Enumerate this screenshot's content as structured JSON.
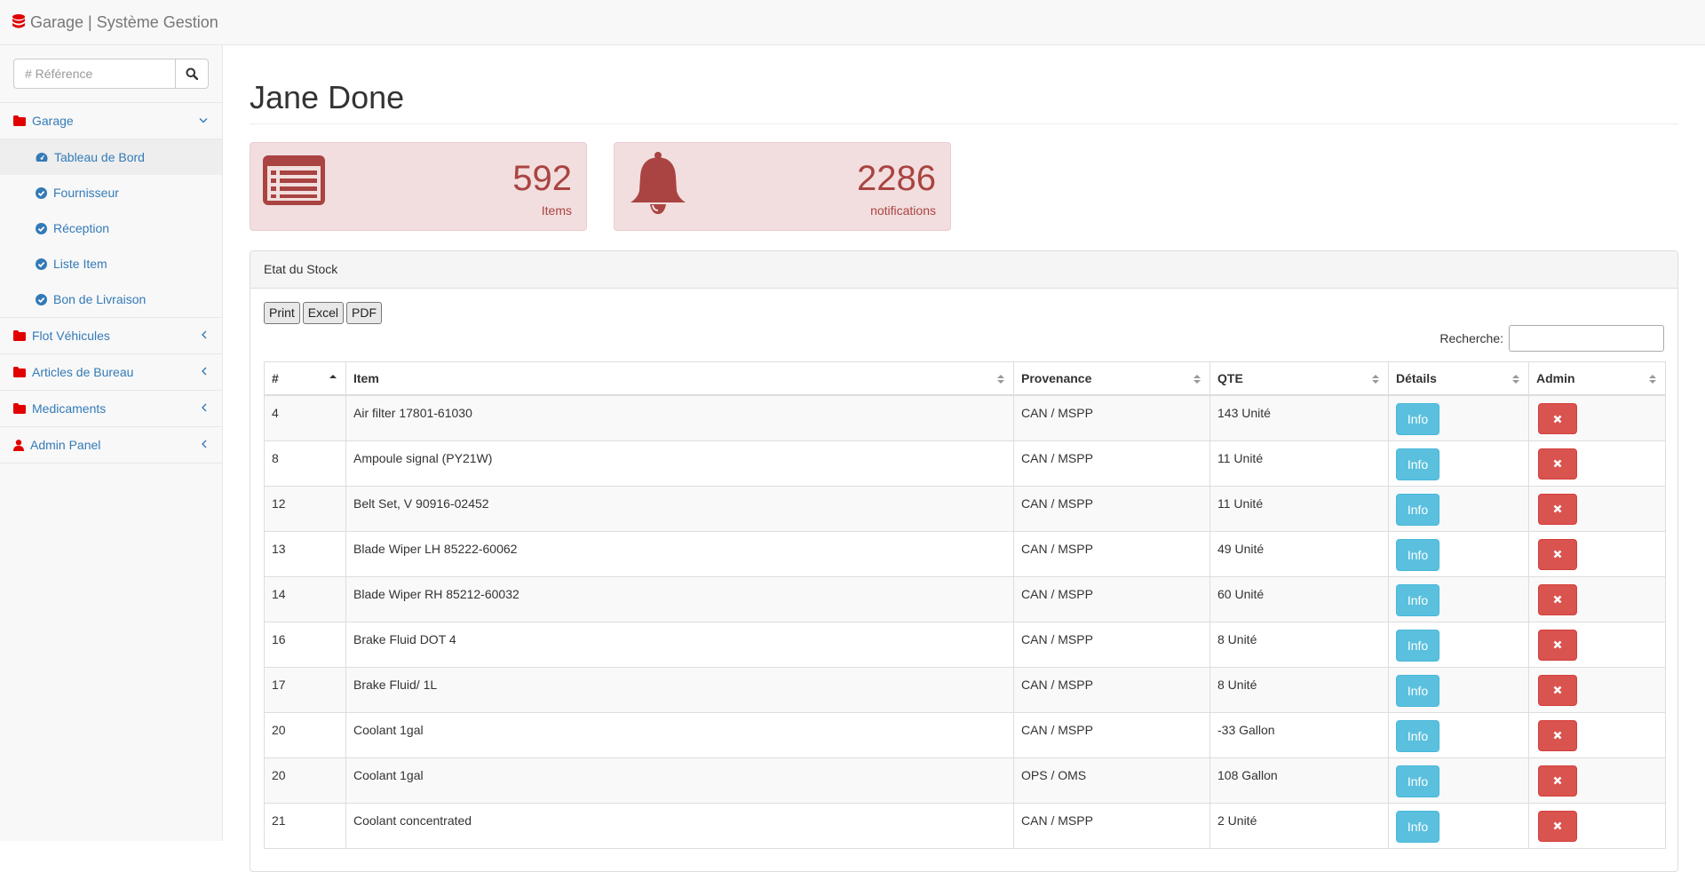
{
  "app": {
    "title": "Garage | Système Gestion",
    "brand_color": "#e00000"
  },
  "sidebar": {
    "search_placeholder": "# Référence",
    "groups": [
      {
        "label": "Garage",
        "icon": "folder-icon",
        "expanded": true,
        "items": [
          {
            "label": "Tableau de Bord",
            "icon": "dashboard-icon",
            "active": true
          },
          {
            "label": "Fournisseur",
            "icon": "check-circle-icon"
          },
          {
            "label": "Réception",
            "icon": "check-circle-icon"
          },
          {
            "label": "Liste Item",
            "icon": "check-circle-icon"
          },
          {
            "label": "Bon de Livraison",
            "icon": "check-circle-icon"
          }
        ]
      },
      {
        "label": "Flot Véhicules",
        "icon": "folder-icon"
      },
      {
        "label": "Articles de Bureau",
        "icon": "folder-icon"
      },
      {
        "label": "Medicaments",
        "icon": "folder-icon"
      },
      {
        "label": "Admin Panel",
        "icon": "user-icon"
      }
    ]
  },
  "main": {
    "title": "Jane Done",
    "stats": [
      {
        "value": "592",
        "label": "Items",
        "icon": "list-icon"
      },
      {
        "value": "2286",
        "label": "notifications",
        "icon": "bell-icon"
      }
    ],
    "panel": {
      "heading": "Etat du Stock",
      "buttons": [
        "Print",
        "Excel",
        "PDF"
      ],
      "search_label": "Recherche:",
      "columns": [
        "#",
        "Item",
        "Provenance",
        "QTE",
        "Détails",
        "Admin"
      ],
      "info_label": "Info",
      "rows": [
        {
          "id": "4",
          "item": "Air filter 17801-61030",
          "prov": "CAN / MSPP",
          "qte": "143 Unité"
        },
        {
          "id": "8",
          "item": "Ampoule signal (PY21W)",
          "prov": "CAN / MSPP",
          "qte": "11 Unité"
        },
        {
          "id": "12",
          "item": "Belt Set, V 90916-02452",
          "prov": "CAN / MSPP",
          "qte": "11 Unité"
        },
        {
          "id": "13",
          "item": "Blade Wiper LH 85222-60062",
          "prov": "CAN / MSPP",
          "qte": "49 Unité"
        },
        {
          "id": "14",
          "item": "Blade Wiper RH 85212-60032",
          "prov": "CAN / MSPP",
          "qte": "60 Unité"
        },
        {
          "id": "16",
          "item": "Brake Fluid DOT 4",
          "prov": "CAN / MSPP",
          "qte": "8 Unité"
        },
        {
          "id": "17",
          "item": "Brake Fluid/ 1L",
          "prov": "CAN / MSPP",
          "qte": "8 Unité"
        },
        {
          "id": "20",
          "item": "Coolant 1gal",
          "prov": "CAN / MSPP",
          "qte": "-33 Gallon"
        },
        {
          "id": "20",
          "item": "Coolant 1gal",
          "prov": "OPS / OMS",
          "qte": "108 Gallon"
        },
        {
          "id": "21",
          "item": "Coolant concentrated",
          "prov": "CAN / MSPP",
          "qte": "2 Unité"
        }
      ]
    }
  }
}
